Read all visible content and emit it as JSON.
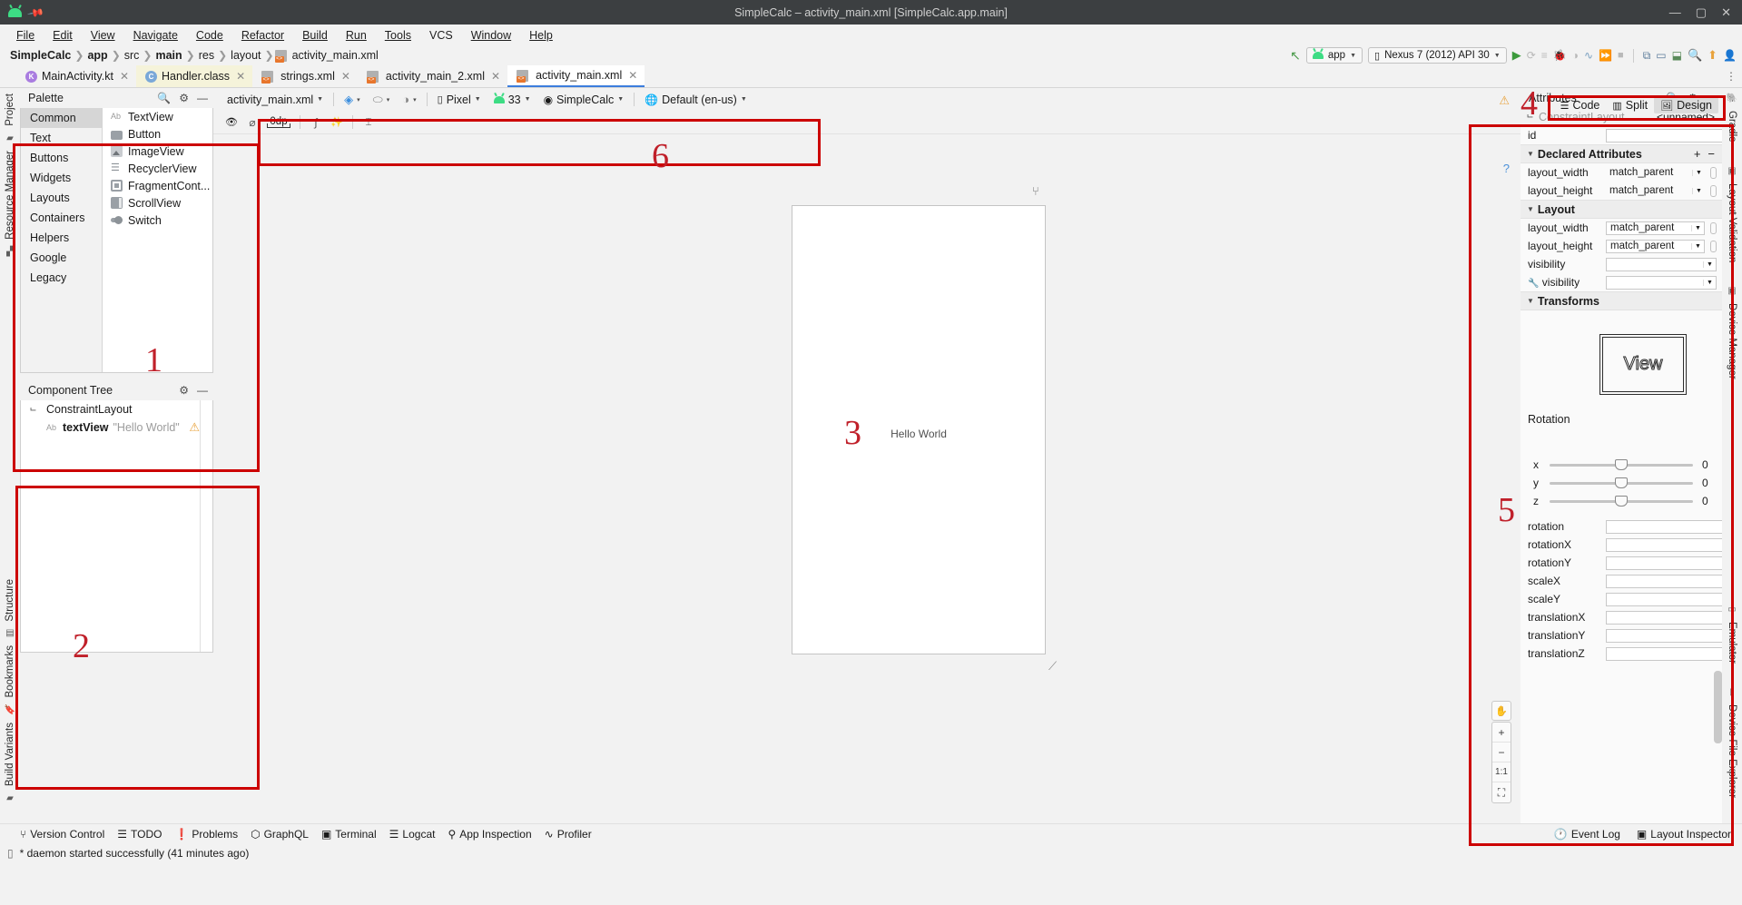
{
  "window": {
    "title": "SimpleCalc – activity_main.xml [SimpleCalc.app.main]",
    "minimize": "—",
    "maximize": "▢",
    "close": "✕",
    "app_icon": "android-robot-icon",
    "pin_icon": "pin-icon"
  },
  "menu": [
    "File",
    "Edit",
    "View",
    "Navigate",
    "Code",
    "Refactor",
    "Build",
    "Run",
    "Tools",
    "VCS",
    "Window",
    "Help"
  ],
  "breadcrumb": [
    "SimpleCalc",
    "app",
    "src",
    "main",
    "res",
    "layout",
    "activity_main.xml"
  ],
  "run_toolbar": {
    "module": "app",
    "device": "Nexus 7 (2012) API 30",
    "run_label": "▶",
    "icons": [
      "run-icon",
      "apply-changes-icon",
      "apply-code-changes-icon",
      "debug-icon",
      "attach-debugger-icon",
      "profiler-icon",
      "run-with-coverage-icon",
      "stop-icon",
      "sdk-manager-icon",
      "avd-manager-icon",
      "device-file-icon",
      "search-icon",
      "update-icon",
      "account-icon"
    ]
  },
  "editor_tabs": [
    {
      "label": "MainActivity.kt",
      "icon": "kotlin-file-icon",
      "state": "normal",
      "close": "✕"
    },
    {
      "label": "Handler.class",
      "icon": "class-file-icon",
      "state": "highlight",
      "close": "✕"
    },
    {
      "label": "strings.xml",
      "icon": "xml-file-icon",
      "state": "normal",
      "close": "✕"
    },
    {
      "label": "activity_main_2.xml",
      "icon": "xml-file-icon",
      "state": "normal",
      "close": "✕"
    },
    {
      "label": "activity_main.xml",
      "icon": "xml-file-icon",
      "state": "selected",
      "close": "✕"
    }
  ],
  "view_modes": {
    "code": "Code",
    "split": "Split",
    "design": "Design",
    "selected": "Design"
  },
  "left_rail": [
    "Project",
    "Resource Manager",
    "Structure",
    "Bookmarks",
    "Build Variants"
  ],
  "right_rail": [
    "Gradle",
    "Layout Validation",
    "Device Manager",
    "Emulator",
    "Device File Explorer"
  ],
  "palette": {
    "title": "Palette",
    "search_icon": "search-icon",
    "gear_icon": "gear-icon",
    "minimize_icon": "minimize-icon",
    "categories": [
      "Common",
      "Text",
      "Buttons",
      "Widgets",
      "Layouts",
      "Containers",
      "Helpers",
      "Google",
      "Legacy"
    ],
    "selected_category": "Common",
    "items": [
      {
        "label": "TextView",
        "icon": "textview-icon"
      },
      {
        "label": "Button",
        "icon": "button-icon"
      },
      {
        "label": "ImageView",
        "icon": "imageview-icon"
      },
      {
        "label": "RecyclerView",
        "icon": "recyclerview-icon"
      },
      {
        "label": "FragmentCont...",
        "icon": "fragment-container-icon"
      },
      {
        "label": "ScrollView",
        "icon": "scrollview-icon"
      },
      {
        "label": "Switch",
        "icon": "switch-icon"
      }
    ]
  },
  "component_tree": {
    "title": "Component Tree",
    "gear_icon": "gear-icon",
    "minimize_icon": "minimize-icon",
    "nodes": [
      {
        "label": "ConstraintLayout",
        "icon": "constraintlayout-icon",
        "value": "",
        "warning": ""
      },
      {
        "label": "textView",
        "icon": "textview-icon",
        "value": "\"Hello World\"",
        "warning": "⚠"
      }
    ]
  },
  "design_toolbar": {
    "file_selector": "activity_main.xml",
    "design_mode_icon": "design-surface-icon",
    "blueprint_icon": "blueprint-mode-icon",
    "theme_mode_icon": "night-mode-icon",
    "device": "Pixel",
    "device_icon": "phone-icon",
    "api_level": "33",
    "api_icon": "android-icon",
    "theme": "SimpleCalc",
    "theme_icon": "theme-icon",
    "locale": "Default (en-us)",
    "locale_icon": "globe-icon",
    "warning_icon": "⚠"
  },
  "constraint_toolbar": {
    "buttons": [
      {
        "name": "view-options-icon",
        "glyph": "👁"
      },
      {
        "name": "clear-constraints-icon",
        "glyph": ""
      },
      {
        "name": "default-margin-value",
        "glyph": "0dp"
      },
      {
        "name": "remove-constraints-icon",
        "glyph": ""
      },
      {
        "name": "infer-constraints-icon",
        "glyph": ""
      },
      {
        "name": "baseline-guideline-icon",
        "glyph": ""
      }
    ],
    "margin_value": "0dp",
    "help_icon": "?"
  },
  "canvas": {
    "preview_text": "Hello World",
    "zoom_controls": {
      "zoom_in": "+",
      "zoom_out": "−",
      "reset": "1:1",
      "fit": "⛶"
    },
    "pan_icon": "pan-tool-icon",
    "resize_handle_icon": "resize-handle-icon"
  },
  "attributes": {
    "title": "Attributes",
    "search_icon": "search-icon",
    "gear_icon": "gear-icon",
    "minimize_icon": "minimize-icon",
    "component_type": "ConstraintLayout",
    "component_name": "<unnamed>",
    "id_label": "id",
    "id_value": "",
    "sections": [
      {
        "name": "Declared Attributes",
        "add_icon": "+",
        "remove_icon": "−",
        "rows": [
          {
            "label": "layout_width",
            "value": "match_parent",
            "type": "combo"
          },
          {
            "label": "layout_height",
            "value": "match_parent",
            "type": "combo"
          }
        ]
      },
      {
        "name": "Layout",
        "rows": [
          {
            "label": "layout_width",
            "value": "match_parent",
            "type": "combo-bordered"
          },
          {
            "label": "layout_height",
            "value": "match_parent",
            "type": "combo-bordered"
          },
          {
            "label": "visibility",
            "value": "",
            "type": "combo-bordered"
          },
          {
            "label": "visibility",
            "value": "",
            "type": "combo-bordered",
            "tool": "wrench-icon"
          }
        ]
      },
      {
        "name": "Transforms"
      }
    ],
    "transform_preview_label": "View",
    "rotation_title": "Rotation",
    "rotation_sliders": [
      {
        "axis": "x",
        "value": "0"
      },
      {
        "axis": "y",
        "value": "0"
      },
      {
        "axis": "z",
        "value": "0"
      }
    ],
    "transform_fields": [
      {
        "label": "rotation",
        "value": ""
      },
      {
        "label": "rotationX",
        "value": ""
      },
      {
        "label": "rotationY",
        "value": ""
      },
      {
        "label": "scaleX",
        "value": ""
      },
      {
        "label": "scaleY",
        "value": ""
      },
      {
        "label": "translationX",
        "value": ""
      },
      {
        "label": "translationY",
        "value": ""
      },
      {
        "label": "translationZ",
        "value": ""
      }
    ]
  },
  "status_bar": {
    "left_items": [
      {
        "label": "Version Control",
        "icon": "branch-icon"
      },
      {
        "label": "TODO",
        "icon": "todo-icon"
      },
      {
        "label": "Problems",
        "icon": "problems-icon"
      },
      {
        "label": "GraphQL",
        "icon": "graphql-icon"
      },
      {
        "label": "Terminal",
        "icon": "terminal-icon"
      },
      {
        "label": "Logcat",
        "icon": "logcat-icon"
      },
      {
        "label": "App Inspection",
        "icon": "app-inspection-icon"
      },
      {
        "label": "Profiler",
        "icon": "profiler-icon"
      }
    ],
    "right_items": [
      {
        "label": "Event Log",
        "icon": "event-log-icon"
      },
      {
        "label": "Layout Inspector",
        "icon": "layout-inspector-icon"
      }
    ],
    "message": "* daemon started successfully (41 minutes ago)",
    "message_icon": "console-icon"
  },
  "annotations": [
    {
      "num": "1",
      "target": "palette-panel"
    },
    {
      "num": "2",
      "target": "component-tree-panel"
    },
    {
      "num": "3",
      "target": "design-canvas"
    },
    {
      "num": "4",
      "target": "view-mode-tabs"
    },
    {
      "num": "5",
      "target": "attributes-panel"
    },
    {
      "num": "6",
      "target": "design-toolbar"
    }
  ],
  "colors": {
    "annotation_red": "#cc0000",
    "accent_blue": "#3c7ddd",
    "android_green": "#3ddc84",
    "warning_amber": "#e8a33d"
  }
}
